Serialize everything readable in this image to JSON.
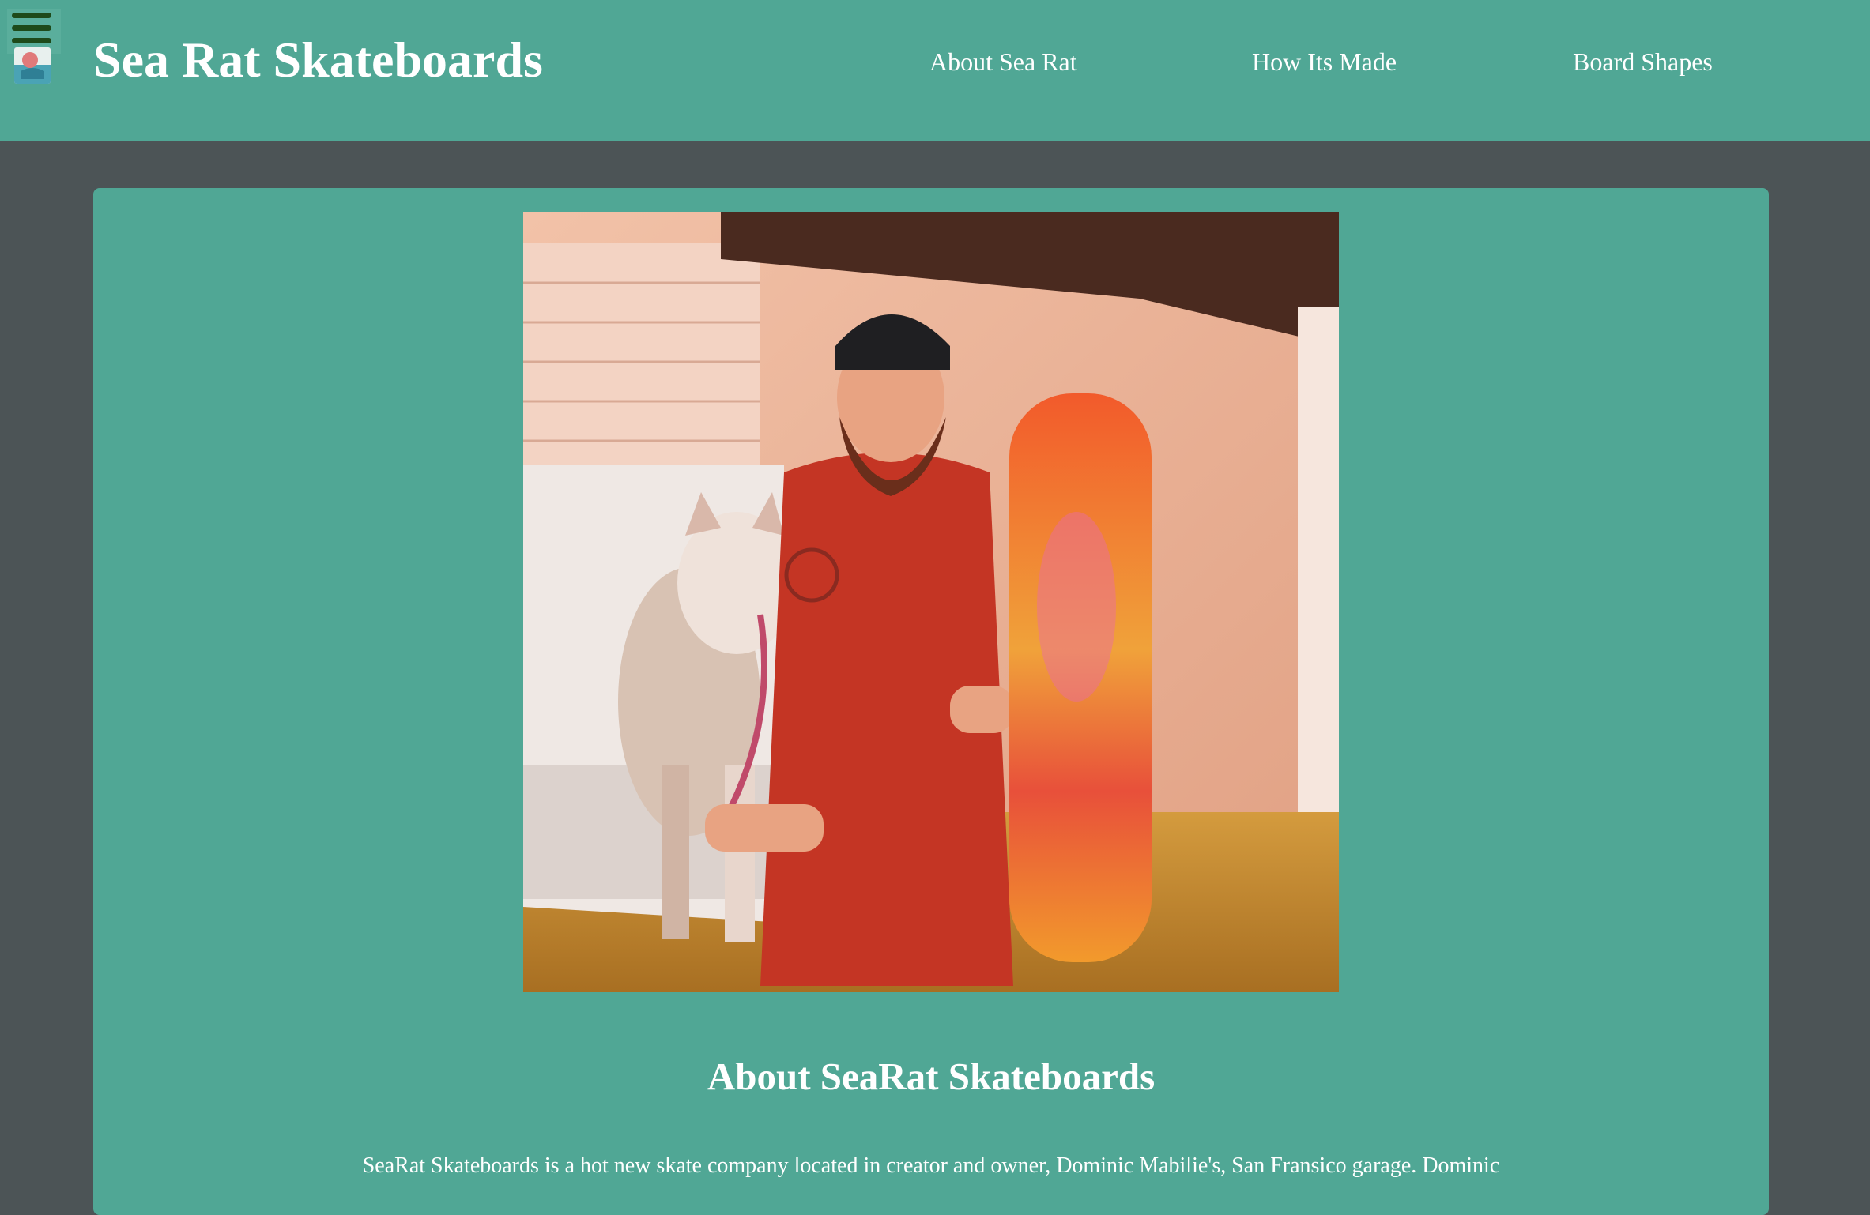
{
  "header": {
    "title": "Sea Rat Skateboards",
    "menu_icon": "hamburger-menu-icon",
    "logo_icon": "sea-rat-logo",
    "background_color": "#50a795"
  },
  "nav": {
    "items": [
      {
        "label": "About Sea Rat"
      },
      {
        "label": "How Its Made"
      },
      {
        "label": "Board Shapes"
      }
    ]
  },
  "main": {
    "hero_image_alt": "Man with a dog holding a skateboard",
    "heading": "About SeaRat Skateboards",
    "intro": "SeaRat Skateboards is a hot new skate company located in creator and owner, Dominic Mabilie's, San Fransico garage. Dominic"
  },
  "colors": {
    "page_background": "#4c5456",
    "card_background": "#50a795",
    "text": "#ffffff",
    "menu_bar": "#1e4a1a"
  }
}
